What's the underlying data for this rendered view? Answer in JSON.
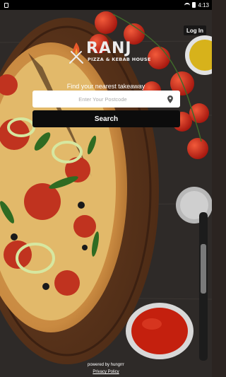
{
  "status_bar": {
    "time": "4:13"
  },
  "header": {
    "login_label": "Log In"
  },
  "brand": {
    "name": "RANJ",
    "tagline": "PIZZA & KEBAB HOUSE"
  },
  "search": {
    "prompt": "Find your nearest takeaway",
    "placeholder": "Enter Your Postcode",
    "button_label": "Search"
  },
  "footer": {
    "powered_by": "powered by hungrrr",
    "privacy_link": "Privacy Policy"
  },
  "icons": {
    "location": "location-pin-icon",
    "brand_mark": "flame-cutlery-icon"
  },
  "colors": {
    "button_bg": "#0c0c0c",
    "input_bg": "#ffffff",
    "flame": "#e8582a"
  }
}
